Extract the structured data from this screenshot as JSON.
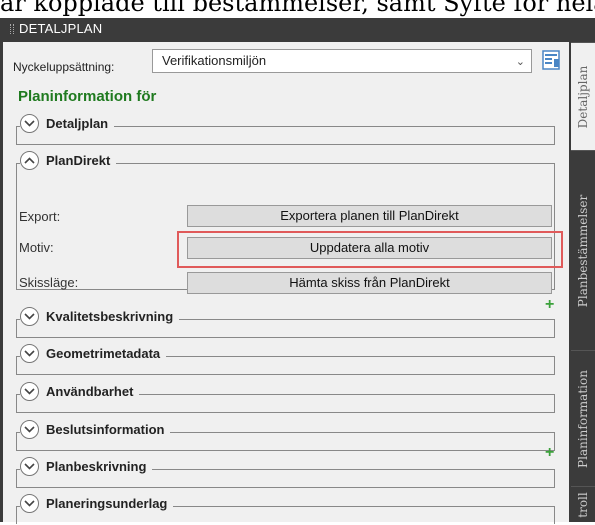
{
  "top_text": "ar kopplade till bestämmelser, samt Syfte för hela",
  "panel": {
    "title": "DETALJPLAN",
    "key_label": "Nyckeluppsättning:",
    "key_value": "Verifikationsmiljön",
    "heading": "Planinformation för"
  },
  "sections": {
    "detaljplan": "Detaljplan",
    "plandirekt": "PlanDirekt",
    "kvalitet": "Kvalitetsbeskrivning",
    "geometri": "Geometrimetadata",
    "anvandbarhet": "Användbarhet",
    "beslut": "Beslutsinformation",
    "planbeskrivning": "Planbeskrivning",
    "planeringsunderlag": "Planeringsunderlag"
  },
  "plandirekt_rows": {
    "export_label": "Export:",
    "export_button": "Exportera planen till PlanDirekt",
    "motiv_label": "Motiv:",
    "motiv_button": "Uppdatera alla motiv",
    "skiss_label": "Skissläge:",
    "skiss_button": "Hämta skiss från PlanDirekt"
  },
  "plus_symbol": "+",
  "side_tabs": {
    "detaljplan": "Detaljplan",
    "planbestammelser": "Planbestämmelser",
    "planinformation": "Planinformation",
    "kontroll": "troll"
  },
  "colors": {
    "heading": "#1f7a1f",
    "highlight": "#e05a5a",
    "panel_dark": "#3b3b3b",
    "plus": "#3ba13b"
  }
}
